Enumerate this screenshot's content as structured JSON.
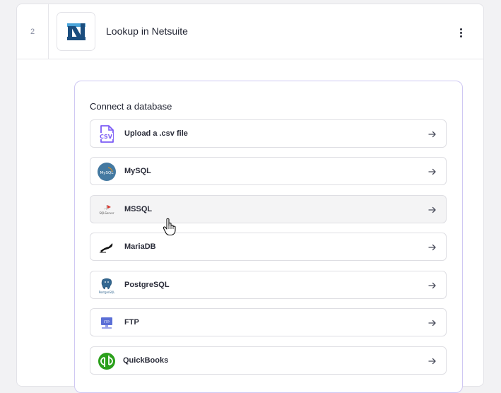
{
  "step": {
    "number": "2",
    "title": "Lookup in Netsuite",
    "logo_icon": "netsuite-logo",
    "menu_icon": "more-vertical-icon"
  },
  "panel": {
    "title": "Connect a database",
    "items": [
      {
        "label": "Upload a .csv file",
        "icon": "csv-file-icon"
      },
      {
        "label": "MySQL",
        "icon": "mysql-icon"
      },
      {
        "label": "MSSQL",
        "icon": "mssql-icon"
      },
      {
        "label": "MariaDB",
        "icon": "mariadb-icon"
      },
      {
        "label": "PostgreSQL",
        "icon": "postgresql-icon"
      },
      {
        "label": "FTP",
        "icon": "ftp-icon"
      },
      {
        "label": "QuickBooks",
        "icon": "quickbooks-icon"
      }
    ]
  },
  "icon_text": {
    "csv": "CSV",
    "mysql": "MySQL",
    "mssql": "SQLServer",
    "postgres": "PostgreSQL",
    "ftp": "FTP"
  },
  "colors": {
    "accent": "#7c5cf5",
    "panel_border": "#cfc8f3",
    "hover_row": "#f4f4f5",
    "netsuite_blue": "#1b4d7e",
    "mysql_blue": "#4479a1",
    "quickbooks_green": "#2ca01c"
  }
}
